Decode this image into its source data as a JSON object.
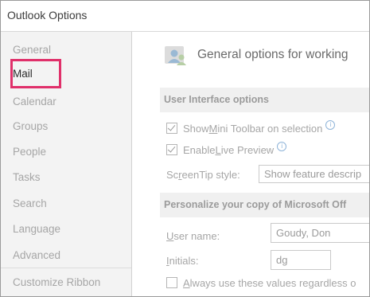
{
  "window": {
    "title": "Outlook Options"
  },
  "sidebar": {
    "items": [
      {
        "label": "General",
        "selected": false
      },
      {
        "label": "Mail",
        "selected": true
      },
      {
        "label": "Calendar",
        "selected": false
      },
      {
        "label": "Groups",
        "selected": false
      },
      {
        "label": "People",
        "selected": false
      },
      {
        "label": "Tasks",
        "selected": false
      },
      {
        "label": "Search",
        "selected": false
      },
      {
        "label": "Language",
        "selected": false
      },
      {
        "label": "Advanced",
        "selected": false
      },
      {
        "label": "Customize Ribbon",
        "selected": false
      }
    ],
    "highlight_color": "#e0306a"
  },
  "content": {
    "heading": "General options for working",
    "heading_icon": "people-icon",
    "ui_section": {
      "title": "User Interface options",
      "mini_toolbar": {
        "pre": "Show ",
        "u": "M",
        "post": "ini Toolbar on selection",
        "checked": true
      },
      "live_preview": {
        "pre": "Enable ",
        "u": "L",
        "post": "ive Preview",
        "checked": true
      },
      "screentip": {
        "pre": "Sc",
        "u": "r",
        "post": "eenTip style:",
        "value": "Show feature descrip"
      }
    },
    "personalize_section": {
      "title": "Personalize your copy of Microsoft Off",
      "user_name": {
        "label_u": "U",
        "label_rest": "ser name:",
        "value": "Goudy, Don"
      },
      "initials": {
        "label_u": "I",
        "label_rest": "nitials:",
        "value": "dg"
      },
      "always_use": {
        "u": "A",
        "post": "lways use these values regardless o",
        "checked": false
      }
    }
  }
}
